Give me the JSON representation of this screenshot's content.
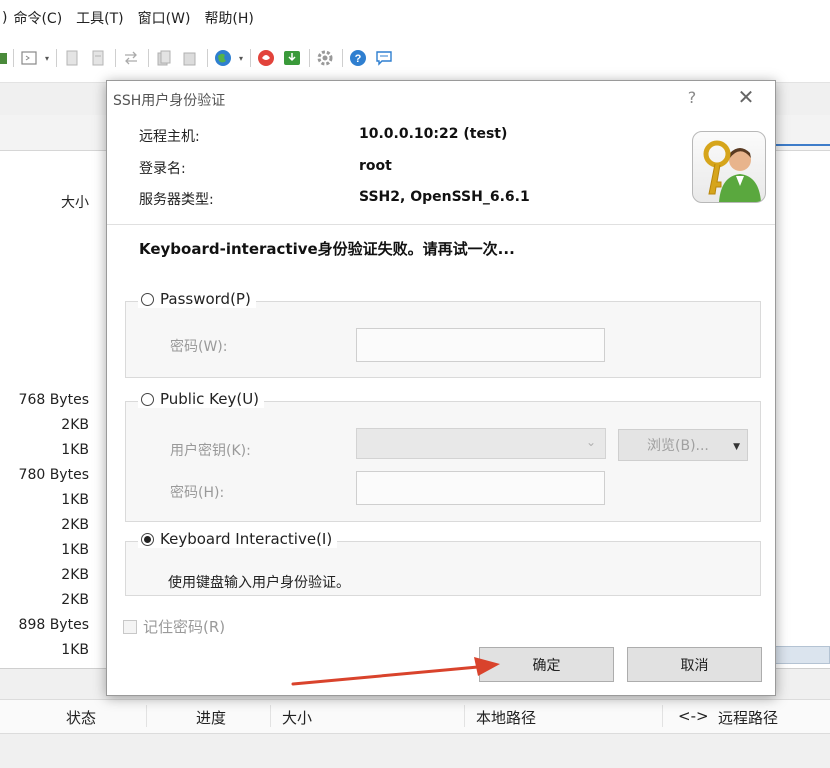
{
  "menubar": {
    "partial_paren": ")",
    "items": [
      "命令(C)",
      "工具(T)",
      "窗口(W)",
      "帮助(H)"
    ]
  },
  "toolbar": {
    "icons": [
      "session-icon",
      "terminal-icon",
      "new-file-icon",
      "open-file-icon",
      "transfer-icon",
      "copy-icon",
      "paste-icon",
      "globe-icon",
      "user-icon",
      "download-icon",
      "settings-icon",
      "help-icon",
      "chat-icon"
    ]
  },
  "file_list": {
    "size_header": "大小",
    "sizes": [
      "768 Bytes",
      "2KB",
      "1KB",
      "780 Bytes",
      "1KB",
      "2KB",
      "1KB",
      "2KB",
      "2KB",
      "898 Bytes",
      "1KB"
    ]
  },
  "transfer_header": {
    "columns": [
      "状态",
      "进度",
      "大小",
      "本地路径",
      "<->",
      "远程路径"
    ]
  },
  "dialog": {
    "title": "SSH用户身份验证",
    "help": "?",
    "close": "✕",
    "info": {
      "host_label": "远程主机:",
      "host_value": "10.0.0.10:22 (test)",
      "login_label": "登录名:",
      "login_value": "root",
      "server_label": "服务器类型:",
      "server_value": "SSH2, OpenSSH_6.6.1"
    },
    "error_message": "Keyboard-interactive身份验证失败。请再试一次...",
    "password_group": {
      "label": "Password(P)",
      "password_label": "密码(W):",
      "password_value": "",
      "selected": false
    },
    "publickey_group": {
      "label": "Public Key(U)",
      "userkey_label": "用户密钥(K):",
      "userkey_value": "",
      "browse_label": "浏览(B)...",
      "password_label": "密码(H):",
      "password_value": "",
      "selected": false
    },
    "keyboard_group": {
      "label": "Keyboard Interactive(I)",
      "description": "使用键盘输入用户身份验证。",
      "selected": true
    },
    "remember_password": {
      "label": "记住密码(R)",
      "checked": false
    },
    "buttons": {
      "ok": "确定",
      "cancel": "取消"
    }
  },
  "colors": {
    "accent_blue": "#3d7cc9",
    "arrow_red": "#d9432c",
    "dialog_bg": "#ffffff",
    "group_bg": "#f7f7f7"
  }
}
